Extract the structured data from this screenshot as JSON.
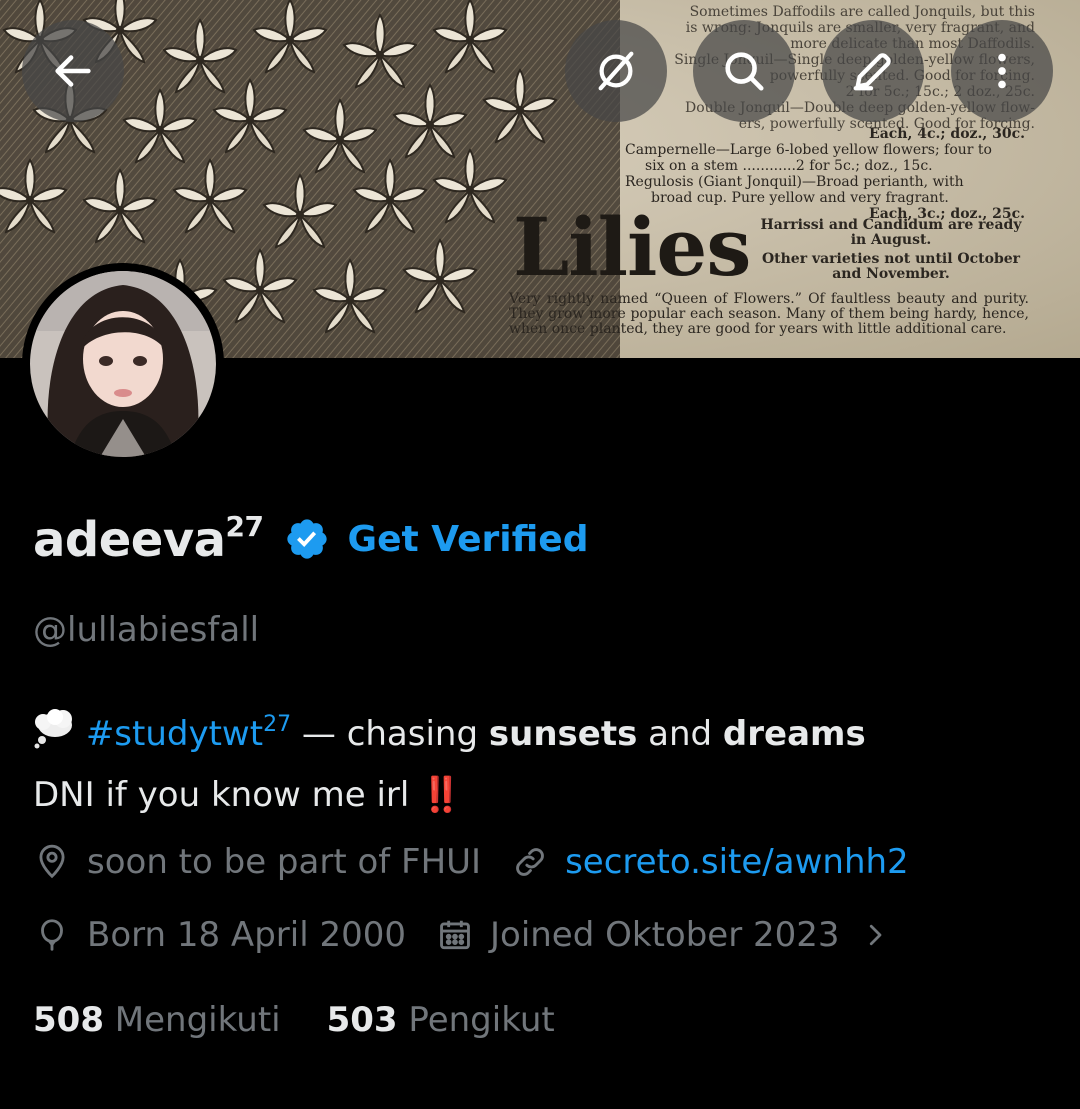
{
  "banner": {
    "ad": {
      "top_lines": [
        "Sometimes Daffodils are called Jonquils, but this",
        "is wrong: Jonquils are smaller, very fragrant, and",
        "more delicate than most Daffodils.",
        "Single Jonquil—Single deep golden-yellow flowers,",
        "powerfully scented.   Good for forcing.",
        "2 for 5c.; 15c.; 2 doz., 25c.",
        "Double Jonquil—Double deep golden-yellow flow-",
        "ers, powerfully scented.   Good for forcing."
      ],
      "each1": "Each, 4c.; doz., 30c.",
      "campernelle": "Campernelle—Large 6-lobed yellow flowers; four to",
      "stem": "six on a stem ............2 for 5c.; doz., 15c.",
      "regulosis": "Regulosis (Giant Jonquil)—Broad perianth, with",
      "cup": "broad cup.   Pure yellow and very fragrant.",
      "each2": "Each, 3c.; doz., 25c.",
      "heading": "Lilies",
      "ready": "Harrissi and Candidum are ready in August.",
      "other": "Other varieties not until October and November.",
      "paragraph": "Very rightly named “Queen of Flowers.”  Of faultless beauty and purity.  They grow more popular each season.  Many of them being hardy, hence, when once planted, they are good for years with little additional care."
    }
  },
  "toolbar": {
    "back": "arrow-left-icon",
    "grok": "slash-circle-icon",
    "search": "search-icon",
    "edit": "pencil-icon",
    "more": "more-vertical-icon"
  },
  "profile": {
    "name": "adeeva",
    "name_sup": "27",
    "get_verified": "Get Verified",
    "handle": "@lullabiesfall",
    "bio": {
      "tag": "#studytwt",
      "tag_sup": "27",
      "dash": " — chasing ",
      "word1": "sunsets",
      "and": " and ",
      "word2": "dreams",
      "line2": "DNI if you know me irl ",
      "bang": "‼️"
    },
    "location": "soon to be part of FHUI",
    "website": "secreto.site/awnhh2",
    "birthday": "Born 18 April 2000",
    "joined": "Joined Oktober 2023",
    "following_count": "508",
    "following_label": "Mengikuti",
    "followers_count": "503",
    "followers_label": "Pengikut"
  },
  "colors": {
    "accent": "#1d9bf0",
    "muted": "#71767b",
    "text": "#e7e9ea",
    "background": "#000000"
  }
}
